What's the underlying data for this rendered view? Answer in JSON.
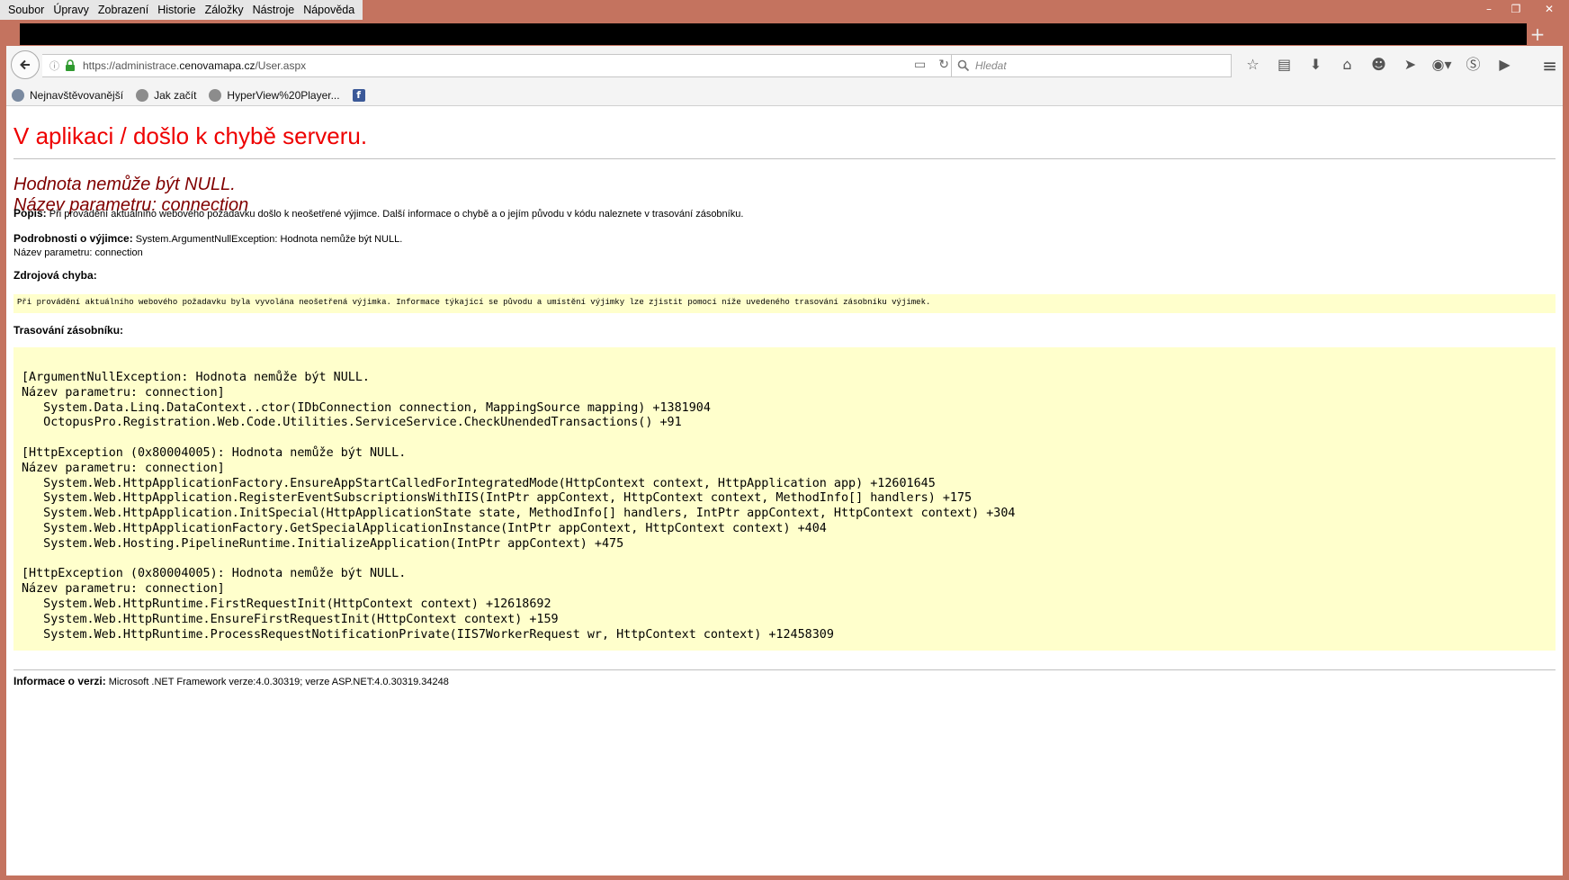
{
  "menu": {
    "items": [
      "Soubor",
      "Úpravy",
      "Zobrazení",
      "Historie",
      "Záložky",
      "Nástroje",
      "Nápověda"
    ]
  },
  "window": {
    "minimize": "–",
    "maximize": "❐",
    "close": "✕"
  },
  "toolbar": {
    "url_prefix": "https://administrace.",
    "url_domain": "cenovamapa.cz",
    "url_path": "/User.aspx",
    "search_placeholder": "Hledat",
    "new_tab": "+"
  },
  "bookmarks": [
    "Nejnavštěvovanější",
    "Jak začít",
    "HyperView%20Player...",
    ""
  ],
  "page": {
    "title": "V aplikaci / došlo k chybě serveru.",
    "error_line1": "Hodnota nemůže být NULL.",
    "error_line2": "Název parametru: connection",
    "desc_label": "Popis:",
    "desc_text": " Při provádění aktuálního webového požadavku došlo k neošetřené výjimce. Další informace o chybě a o jejím původu v kódu naleznete v trasování zásobníku.",
    "exc_label": "Podrobnosti o výjimce:",
    "exc_text": " System.ArgumentNullException: Hodnota nemůže být NULL.",
    "exc_text2": "Název parametru: connection",
    "source_label": "Zdrojová chyba:",
    "source_text": "Při provádění aktuálního webového požadavku byla vyvolána neošetřená výjimka. Informace týkající se původu a umístění výjimky lze zjistit pomocí níže uvedeného trasování zásobníku výjimek.",
    "stack_label": "Trasování zásobníku:",
    "stack_trace": "[ArgumentNullException: Hodnota nemůže být NULL.\nNázev parametru: connection]\n   System.Data.Linq.DataContext..ctor(IDbConnection connection, MappingSource mapping) +1381904\n   OctopusPro.Registration.Web.Code.Utilities.ServiceService.CheckUnendedTransactions() +91\n\n[HttpException (0x80004005): Hodnota nemůže být NULL.\nNázev parametru: connection]\n   System.Web.HttpApplicationFactory.EnsureAppStartCalledForIntegratedMode(HttpContext context, HttpApplication app) +12601645\n   System.Web.HttpApplication.RegisterEventSubscriptionsWithIIS(IntPtr appContext, HttpContext context, MethodInfo[] handlers) +175\n   System.Web.HttpApplication.InitSpecial(HttpApplicationState state, MethodInfo[] handlers, IntPtr appContext, HttpContext context) +304\n   System.Web.HttpApplicationFactory.GetSpecialApplicationInstance(IntPtr appContext, HttpContext context) +404\n   System.Web.Hosting.PipelineRuntime.InitializeApplication(IntPtr appContext) +475\n\n[HttpException (0x80004005): Hodnota nemůže být NULL.\nNázev parametru: connection]\n   System.Web.HttpRuntime.FirstRequestInit(HttpContext context) +12618692\n   System.Web.HttpRuntime.EnsureFirstRequestInit(HttpContext context) +159\n   System.Web.HttpRuntime.ProcessRequestNotificationPrivate(IIS7WorkerRequest wr, HttpContext context) +12458309",
    "version_label": "Informace o verzi:",
    "version_text": " Microsoft .NET Framework verze:4.0.30319; verze ASP.NET:4.0.30319.34248"
  },
  "colors": {
    "title_red": "#e00000",
    "subtitle_maroon": "#800000",
    "code_bg": "#ffffcc",
    "window_frame": "#c4735f"
  }
}
